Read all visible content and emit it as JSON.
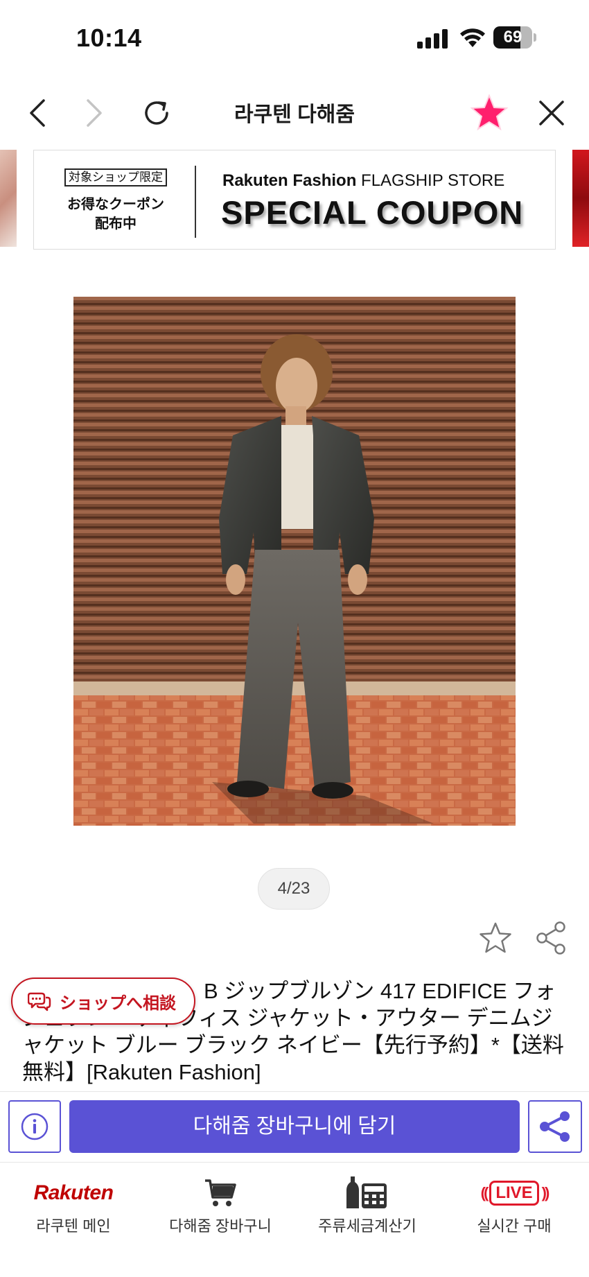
{
  "status_bar": {
    "time": "10:14",
    "battery": "69",
    "battery_level_percent": 69
  },
  "nav": {
    "title": "라쿠텐 다해줌",
    "star_color": "#ff1f6d"
  },
  "banner": {
    "limited_label": "対象ショップ限定",
    "coupon_line1": "お得なクーポン",
    "coupon_line2": "配布中",
    "brand_bold": "Rakuten Fashion",
    "brand_sub": "FLAGSHIP STORE",
    "headline": "SPECIAL COUPON"
  },
  "gallery": {
    "pager": "4/23"
  },
  "product": {
    "title": "B ジップブルゾン 417 EDIFICE フォ　　ジェブン エディフィス ジャケット・アウター デニムジャケット ブルー ブラック ネイビー【先行予約】*【送料無料】[Rakuten Fashion]"
  },
  "consult_chip": {
    "label": "ショップへ相談",
    "color": "#c41520"
  },
  "action_bar": {
    "cart_label": "다해줌 장바구니에 담기",
    "accent": "#5a52d5"
  },
  "bottom_nav": {
    "items": [
      {
        "icon": "rakuten-logo",
        "logo_text": "Rakuten",
        "label": "라쿠텐 메인"
      },
      {
        "icon": "cart-icon",
        "label": "다해줌 장바구니"
      },
      {
        "icon": "calculator-icon",
        "label": "주류세금계산기"
      },
      {
        "icon": "live-icon",
        "logo_text": "LIVE",
        "label": "실시간 구매"
      }
    ]
  }
}
